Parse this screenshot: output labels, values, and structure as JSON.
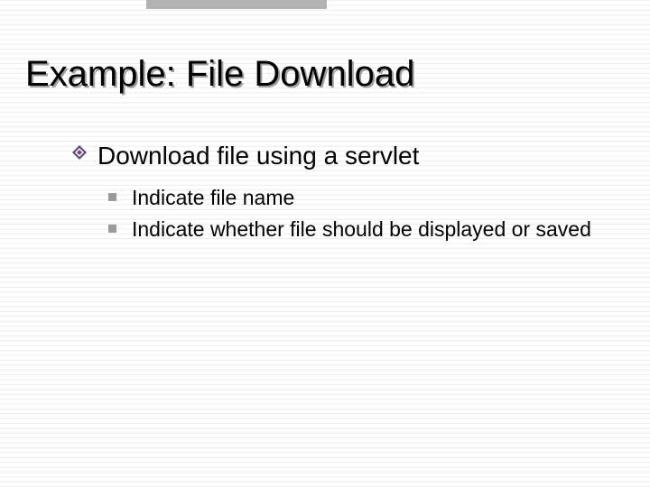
{
  "slide": {
    "title": "Example: File Download",
    "bullets": [
      {
        "text": "Download file using a servlet",
        "children": [
          {
            "text": "Indicate file name"
          },
          {
            "text": "Indicate whether file should be displayed or saved"
          }
        ]
      }
    ]
  },
  "colors": {
    "accent": "#604a7b",
    "sub_bullet": "#9a9a99",
    "band": "#b2b2b2"
  }
}
